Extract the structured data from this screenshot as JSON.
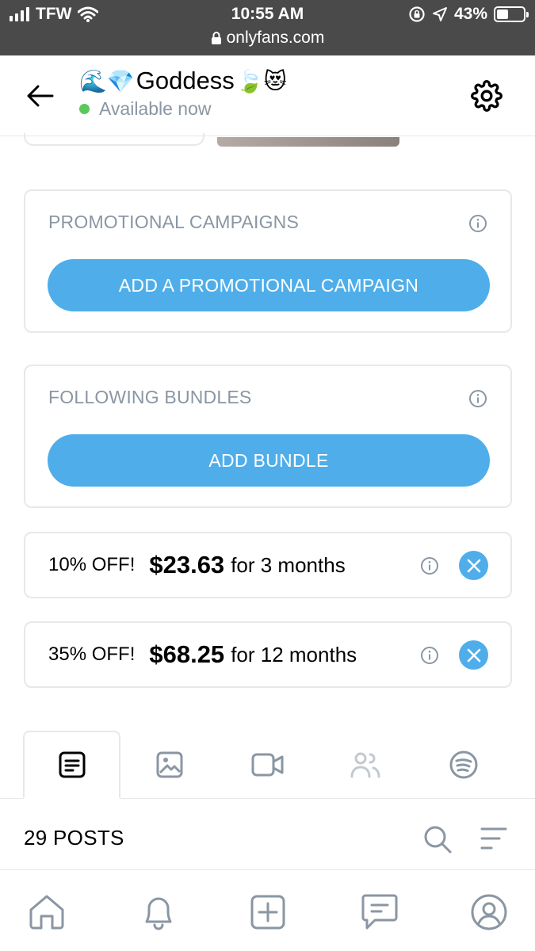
{
  "status_bar": {
    "carrier": "TFW",
    "time": "10:55 AM",
    "url": "onlyfans.com",
    "battery": "43%",
    "battery_level": 0.43
  },
  "header": {
    "emoji_prefix": "🌊💎",
    "name": "Goddess",
    "emoji_suffix": "🍃😻",
    "availability": "Available now",
    "availability_color": "#5ac85a"
  },
  "promotional": {
    "title": "PROMOTIONAL CAMPAIGNS",
    "button_label": "ADD A PROMOTIONAL CAMPAIGN"
  },
  "following_bundles": {
    "title": "FOLLOWING BUNDLES",
    "button_label": "ADD BUNDLE"
  },
  "bundles": [
    {
      "discount": "10% OFF!",
      "price": "$23.63",
      "period": "for 3 months"
    },
    {
      "discount": "35% OFF!",
      "price": "$68.25",
      "period": "for 12 months"
    }
  ],
  "tabs": [
    {
      "icon": "posts-icon",
      "active": true
    },
    {
      "icon": "photo-icon",
      "active": false
    },
    {
      "icon": "video-icon",
      "active": false
    },
    {
      "icon": "users-icon",
      "active": false
    },
    {
      "icon": "spotify-icon",
      "active": false
    }
  ],
  "posts": {
    "count_label": "29 POSTS"
  },
  "bottom_nav": [
    {
      "icon": "home-icon"
    },
    {
      "icon": "bell-icon"
    },
    {
      "icon": "add-post-icon"
    },
    {
      "icon": "messages-icon"
    },
    {
      "icon": "profile-icon"
    }
  ],
  "colors": {
    "accent": "#4faeea",
    "muted_text": "#8a96a3",
    "border": "#e6e8ea",
    "status_bar_bg": "#4a4a4a"
  }
}
